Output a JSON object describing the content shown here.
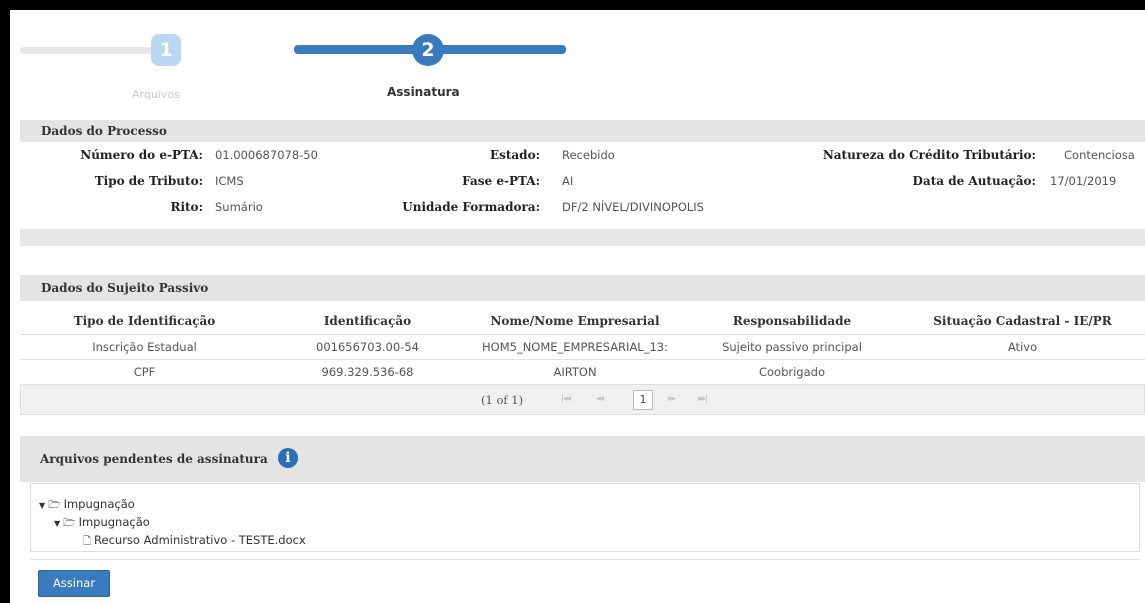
{
  "wizard": {
    "steps": [
      {
        "number": "1",
        "label": "Arquivos"
      },
      {
        "number": "2",
        "label": "Assinatura"
      }
    ]
  },
  "processo": {
    "header": "Dados do Processo",
    "numero_label": "Número do e-PTA:",
    "numero_value": "01.000687078-50",
    "estado_label": "Estado:",
    "estado_value": "Recebido",
    "natureza_label": "Natureza do Crédito Tributário:",
    "natureza_value": "Contenciosa",
    "tipo_tributo_label": "Tipo de Tributo:",
    "tipo_tributo_value": "ICMS",
    "fase_label": "Fase e-PTA:",
    "fase_value": "AI",
    "data_label": "Data de Autuação:",
    "data_value": "17/01/2019",
    "rito_label": "Rito:",
    "rito_value": "Sumário",
    "unidade_label": "Unidade Formadora:",
    "unidade_value": "DF/2 NÍVEL/DIVINOPOLIS"
  },
  "sujeito": {
    "header": "Dados do Sujeito Passivo",
    "columns": [
      "Tipo de Identificação",
      "Identificação",
      "Nome/Nome Empresarial",
      "Responsabilidade",
      "Situação Cadastral - IE/PR"
    ],
    "rows": [
      [
        "Inscrição Estadual",
        "001656703.00-54",
        "HOM5_NOME_EMPRESARIAL_13:",
        "Sujeito passivo principal",
        "Ativo"
      ],
      [
        "CPF",
        "969.329.536-68",
        "AIRTON",
        "Coobrigado",
        ""
      ]
    ],
    "paginator": {
      "text": "(1 of 1)",
      "first": "|◂◂",
      "prev": "◂◂",
      "page": "1",
      "next": "▸▸",
      "last": "▸▸|"
    }
  },
  "arquivos": {
    "header": "Arquivos pendentes de assinatura",
    "info_icon": "info-icon",
    "tree": [
      {
        "label": "Impugnação",
        "level": 0,
        "icon": "folder-open-icon"
      },
      {
        "label": "Impugnação",
        "level": 1,
        "icon": "folder-open-icon"
      },
      {
        "label": "Recurso Administrativo - TESTE.docx",
        "level": 2,
        "icon": "document-icon"
      }
    ]
  },
  "actions": {
    "assinar_label": "Assinar"
  },
  "colors": {
    "accent": "#3a7bbf",
    "header_bg": "#e4e4e4",
    "step_inactive": "#b9d7ee"
  }
}
